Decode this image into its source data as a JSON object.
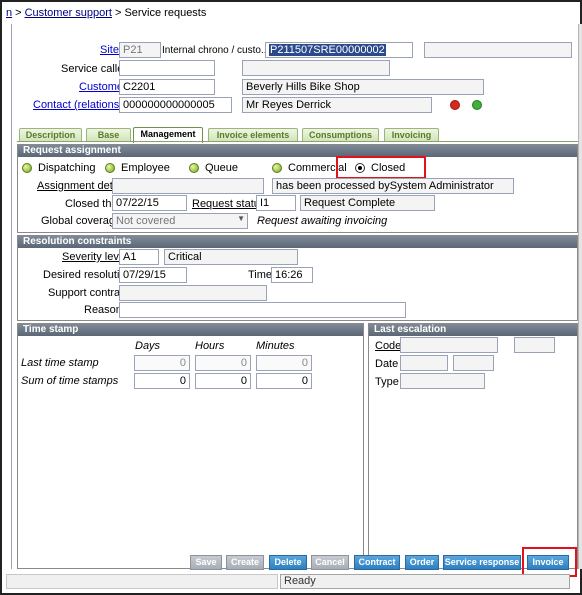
{
  "breadcrumb": {
    "part0": "n",
    "part1": "Customer support",
    "part2": "Service requests"
  },
  "header": {
    "site_label": "Site",
    "site_value": "P21",
    "chrono_label": "Internal chrono / custo...",
    "chrono_value": "P211507SRE00000002",
    "service_caller_label": "Service caller",
    "customer_label": "Customer",
    "customer_code": "C2201",
    "customer_name": "Beverly Hills Bike Shop",
    "contact_label": "Contact (relationship)",
    "contact_code": "000000000000005",
    "contact_name": "Mr Reyes Derrick"
  },
  "tabs": [
    "Description",
    "Base",
    "Management",
    "Invoice elements",
    "Consumptions",
    "Invoicing"
  ],
  "active_tab": "Management",
  "request_assignment": {
    "title": "Request assignment",
    "options": [
      "Dispatching",
      "Employee",
      "Queue",
      "Commercial",
      "Closed"
    ],
    "selected": "Closed",
    "assignment_detail_label": "Assignment detail",
    "assignment_detail_value": "has been processed bySystem Administrator",
    "closed_the_label": "Closed the",
    "closed_the_value": "07/22/15",
    "request_status_label": "Request status",
    "request_status_code": "I1",
    "request_status_text": "Request Complete",
    "global_coverage_label": "Global coverage",
    "global_coverage_value": "Not covered",
    "global_coverage_note": "Request awaiting invoicing"
  },
  "resolution": {
    "title": "Resolution constraints",
    "severity_label": "Severity level",
    "severity_code": "A1",
    "severity_text": "Critical",
    "desired_label": "Desired resolution",
    "desired_value": "07/29/15",
    "time_label": "Time",
    "time_value": "16:26",
    "support_contract_label": "Support contract",
    "reason_label": "Reason"
  },
  "time_stamp": {
    "title": "Time stamp",
    "columns": [
      "Days",
      "Hours",
      "Minutes"
    ],
    "rows": [
      {
        "label": "Last time stamp",
        "values": [
          "0",
          "0",
          "0"
        ]
      },
      {
        "label": "Sum of time stamps",
        "values": [
          "0",
          "0",
          "0"
        ]
      }
    ]
  },
  "last_escalation": {
    "title": "Last escalation",
    "code_label": "Code",
    "date_label": "Date",
    "type_label": "Type"
  },
  "buttons": [
    "Save",
    "Create",
    "Delete",
    "Cancel",
    "Contract",
    "Order",
    "Service response",
    "Invoice"
  ],
  "status": {
    "text": "Ready"
  },
  "colors": {
    "highlight_red": "#e0121b",
    "tab_green": "#5a7a2a",
    "button_blue": "#2e7fc0"
  }
}
